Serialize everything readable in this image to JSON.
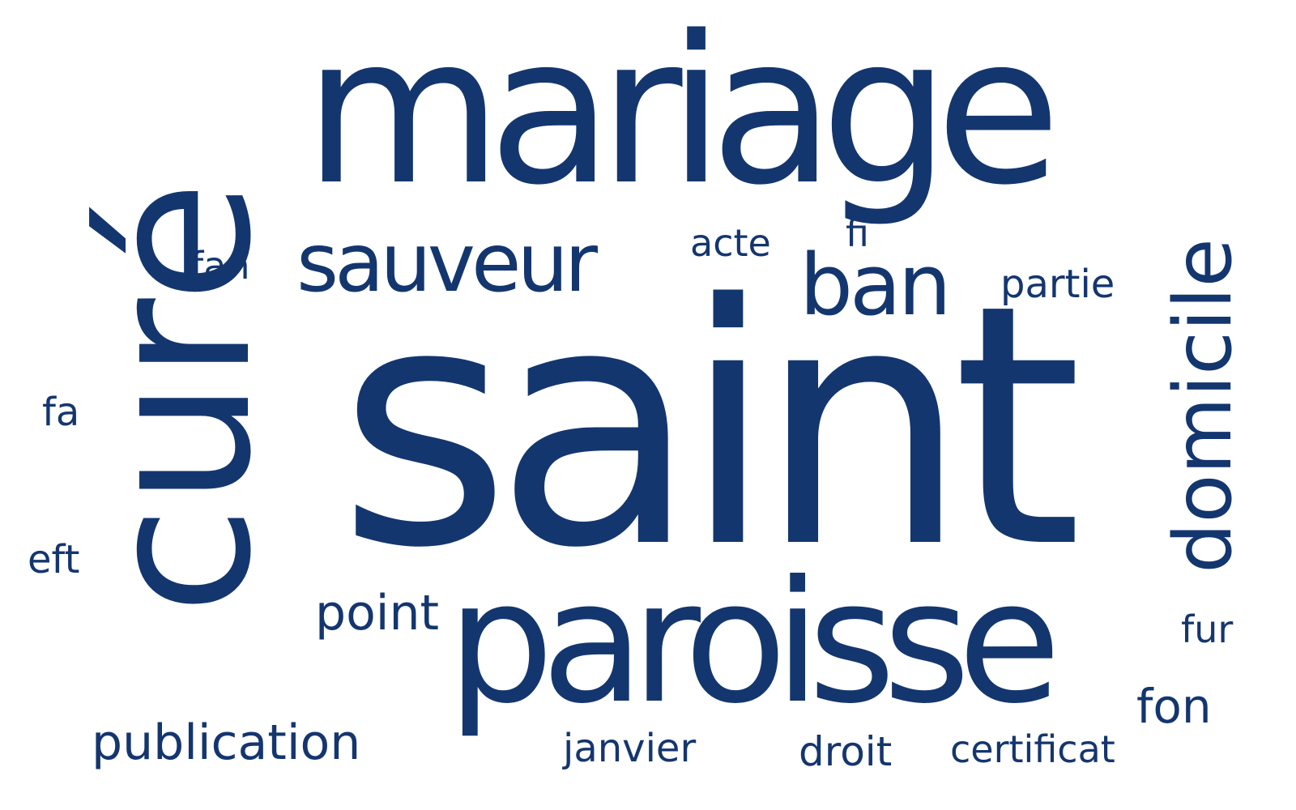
{
  "theme": {
    "text_color": "#14366f",
    "background": "#ffffff"
  },
  "words": {
    "saint": "saint",
    "cure": "curé",
    "mariage": "mariage",
    "paroisse": "paroisse",
    "domicile": "domicile",
    "sauveur": "sauveur",
    "ban": "ban",
    "acte": "acte",
    "fi": "fi",
    "fan": "fan",
    "partie": "partie",
    "fa": "fa",
    "eft": "eft",
    "point": "point",
    "fur": "fur",
    "fon": "fon",
    "publication": "publication",
    "janvier": "janvier",
    "droit": "droit",
    "certificat": "certificat"
  }
}
